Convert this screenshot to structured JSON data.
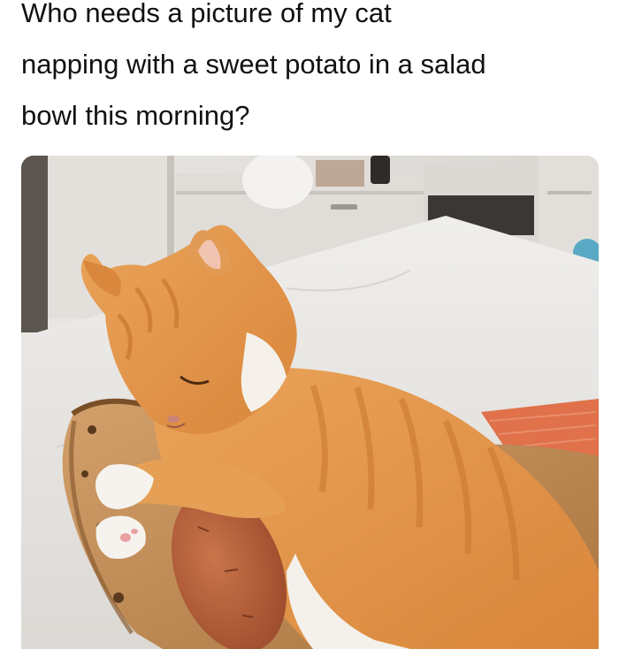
{
  "post": {
    "caption_lines": [
      "Who needs a picture of my cat",
      "napping with a sweet potato in a salad",
      "bowl this morning?"
    ]
  },
  "photo": {
    "subjects": [
      "cat",
      "sweet potato",
      "salad bowl"
    ],
    "colors": {
      "fur": "#e49a4a",
      "fur_dark": "#c9762e",
      "countertop": "#e9e6e2",
      "bowl": "#c8955e",
      "potato": "#b8623a",
      "placemat": "#e0714a"
    }
  }
}
